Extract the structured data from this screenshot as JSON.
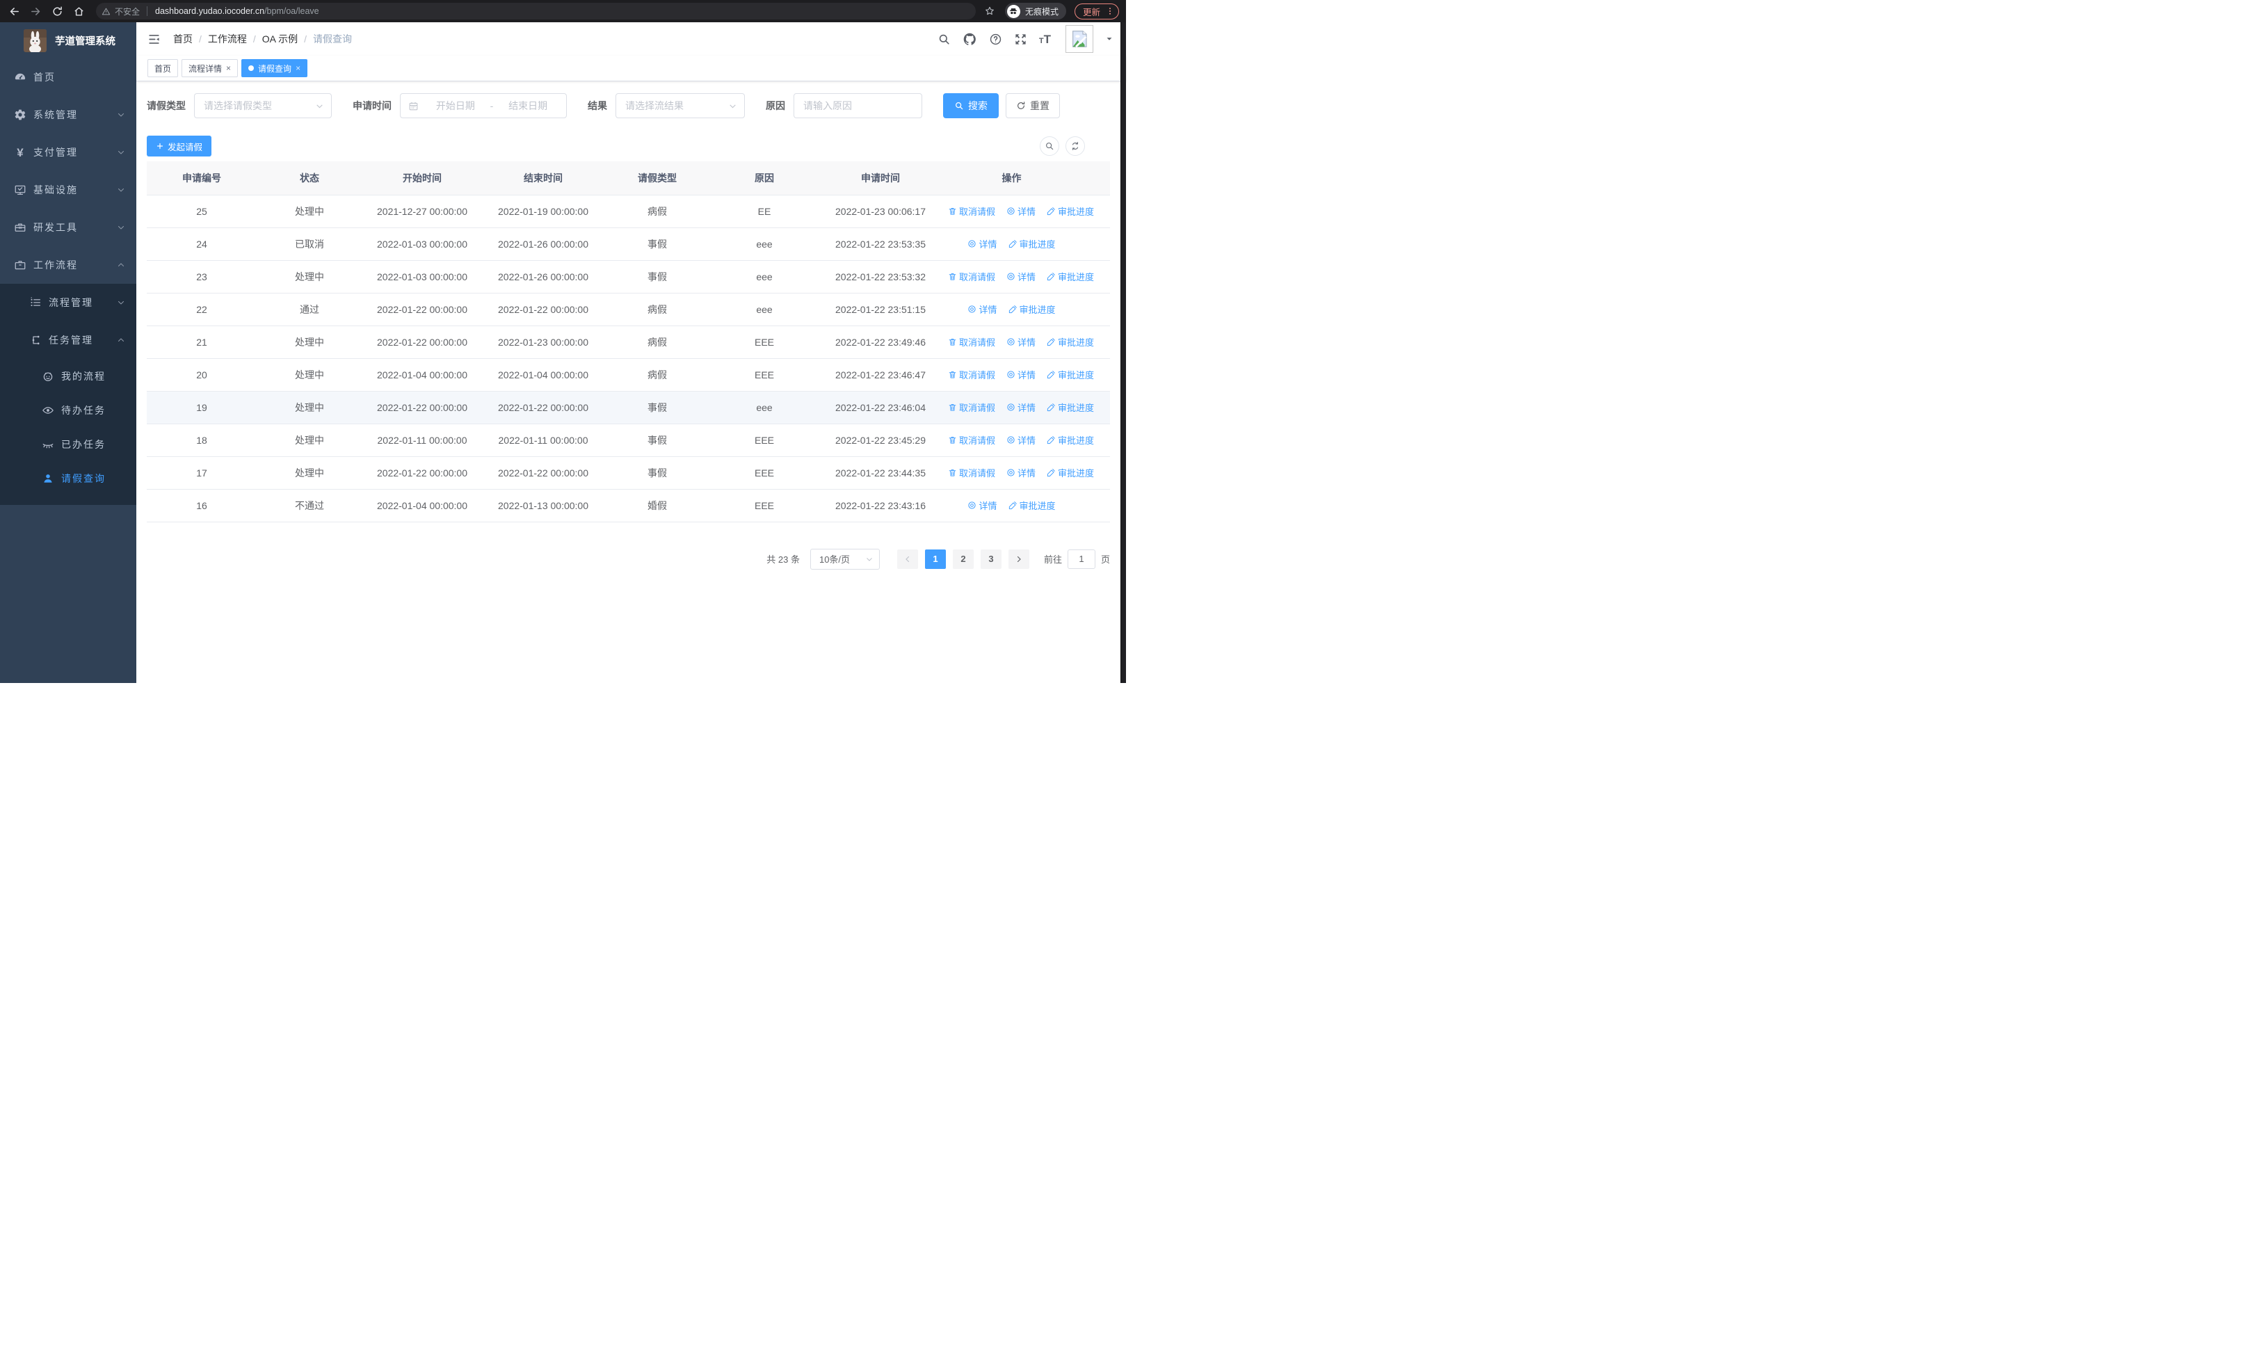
{
  "browser": {
    "security_label": "不安全",
    "url_host": "dashboard.yudao.iocoder.cn",
    "url_path": "/bpm/oa/leave",
    "incognito_label": "无痕模式",
    "update_label": "更新"
  },
  "sidebar": {
    "app_title": "芋道管理系统",
    "menu": [
      {
        "key": "home",
        "label": "首页",
        "icon": "gauge-icon"
      },
      {
        "key": "system-management",
        "label": "系统管理",
        "icon": "gear-icon",
        "chevron": "down"
      },
      {
        "key": "payment-management",
        "label": "支付管理",
        "icon": "yen-icon",
        "chevron": "down"
      },
      {
        "key": "infrastructure",
        "label": "基础设施",
        "icon": "monitor-icon",
        "chevron": "down"
      },
      {
        "key": "dev-tools",
        "label": "研发工具",
        "icon": "toolbox-icon",
        "chevron": "down"
      },
      {
        "key": "workflow",
        "label": "工作流程",
        "icon": "briefcase-icon",
        "chevron": "up",
        "expanded": true,
        "children": [
          {
            "key": "process-management",
            "label": "流程管理",
            "icon": "list-icon",
            "chevron": "down"
          },
          {
            "key": "task-management",
            "label": "任务管理",
            "icon": "org-icon",
            "chevron": "up",
            "expanded": true,
            "children": [
              {
                "key": "my-process",
                "label": "我的流程",
                "icon": "face-icon"
              },
              {
                "key": "todo-tasks",
                "label": "待办任务",
                "icon": "eye-icon"
              },
              {
                "key": "done-tasks",
                "label": "已办任务",
                "icon": "eye-closed-icon"
              },
              {
                "key": "leave-query",
                "label": "请假查询",
                "icon": "person-icon",
                "active": true
              }
            ]
          }
        ]
      }
    ]
  },
  "header": {
    "breadcrumb": [
      "首页",
      "工作流程",
      "OA 示例",
      "请假查询"
    ],
    "breadcrumb_separator": "/",
    "tabs": [
      {
        "key": "home",
        "label": "首页",
        "closable": false,
        "active": false
      },
      {
        "key": "process-detail",
        "label": "流程详情",
        "closable": true,
        "active": false
      },
      {
        "key": "leave-query",
        "label": "请假查询",
        "closable": true,
        "active": true
      }
    ]
  },
  "filters": {
    "leave_type_label": "请假类型",
    "leave_type_placeholder": "请选择请假类型",
    "apply_time_label": "申请时间",
    "start_placeholder": "开始日期",
    "range_separator": "-",
    "end_placeholder": "结束日期",
    "result_label": "结果",
    "result_placeholder": "请选择流结果",
    "reason_label": "原因",
    "reason_placeholder": "请输入原因",
    "search_label": "搜索",
    "reset_label": "重置"
  },
  "toolbar": {
    "create_label": "发起请假"
  },
  "table": {
    "columns": [
      "申请编号",
      "状态",
      "开始时间",
      "结束时间",
      "请假类型",
      "原因",
      "申请时间",
      "操作"
    ],
    "action_labels": {
      "cancel": "取消请假",
      "detail": "详情",
      "progress": "审批进度"
    },
    "rows": [
      {
        "id": 25,
        "status": "处理中",
        "start": "2021-12-27 00:00:00",
        "end": "2022-01-19 00:00:00",
        "type": "病假",
        "reason": "EE",
        "applied": "2022-01-23 00:06:17",
        "actions": [
          "cancel",
          "detail",
          "progress"
        ],
        "highlight": false
      },
      {
        "id": 24,
        "status": "已取消",
        "start": "2022-01-03 00:00:00",
        "end": "2022-01-26 00:00:00",
        "type": "事假",
        "reason": "eee",
        "applied": "2022-01-22 23:53:35",
        "actions": [
          "detail",
          "progress"
        ],
        "highlight": false
      },
      {
        "id": 23,
        "status": "处理中",
        "start": "2022-01-03 00:00:00",
        "end": "2022-01-26 00:00:00",
        "type": "事假",
        "reason": "eee",
        "applied": "2022-01-22 23:53:32",
        "actions": [
          "cancel",
          "detail",
          "progress"
        ],
        "highlight": false
      },
      {
        "id": 22,
        "status": "通过",
        "start": "2022-01-22 00:00:00",
        "end": "2022-01-22 00:00:00",
        "type": "病假",
        "reason": "eee",
        "applied": "2022-01-22 23:51:15",
        "actions": [
          "detail",
          "progress"
        ],
        "highlight": false
      },
      {
        "id": 21,
        "status": "处理中",
        "start": "2022-01-22 00:00:00",
        "end": "2022-01-23 00:00:00",
        "type": "病假",
        "reason": "EEE",
        "applied": "2022-01-22 23:49:46",
        "actions": [
          "cancel",
          "detail",
          "progress"
        ],
        "highlight": false
      },
      {
        "id": 20,
        "status": "处理中",
        "start": "2022-01-04 00:00:00",
        "end": "2022-01-04 00:00:00",
        "type": "病假",
        "reason": "EEE",
        "applied": "2022-01-22 23:46:47",
        "actions": [
          "cancel",
          "detail",
          "progress"
        ],
        "highlight": false
      },
      {
        "id": 19,
        "status": "处理中",
        "start": "2022-01-22 00:00:00",
        "end": "2022-01-22 00:00:00",
        "type": "事假",
        "reason": "eee",
        "applied": "2022-01-22 23:46:04",
        "actions": [
          "cancel",
          "detail",
          "progress"
        ],
        "highlight": true
      },
      {
        "id": 18,
        "status": "处理中",
        "start": "2022-01-11 00:00:00",
        "end": "2022-01-11 00:00:00",
        "type": "事假",
        "reason": "EEE",
        "applied": "2022-01-22 23:45:29",
        "actions": [
          "cancel",
          "detail",
          "progress"
        ],
        "highlight": false
      },
      {
        "id": 17,
        "status": "处理中",
        "start": "2022-01-22 00:00:00",
        "end": "2022-01-22 00:00:00",
        "type": "事假",
        "reason": "EEE",
        "applied": "2022-01-22 23:44:35",
        "actions": [
          "cancel",
          "detail",
          "progress"
        ],
        "highlight": false
      },
      {
        "id": 16,
        "status": "不通过",
        "start": "2022-01-04 00:00:00",
        "end": "2022-01-13 00:00:00",
        "type": "婚假",
        "reason": "EEE",
        "applied": "2022-01-22 23:43:16",
        "actions": [
          "detail",
          "progress"
        ],
        "highlight": false
      }
    ]
  },
  "pagination": {
    "total_label": "共 23 条",
    "page_size_label": "10条/页",
    "pages": [
      "1",
      "2",
      "3"
    ],
    "active_page": "1",
    "goto_label": "前往",
    "goto_value": "1",
    "unit_label": "页"
  },
  "colors": {
    "accent": "#409eff",
    "sidebar_bg": "#304156",
    "submenu_bg": "#1f2d3d",
    "sidebar_text": "#bfcbd9",
    "table_header_bg": "#f8f8f9",
    "update_badge": "#e8847d"
  }
}
